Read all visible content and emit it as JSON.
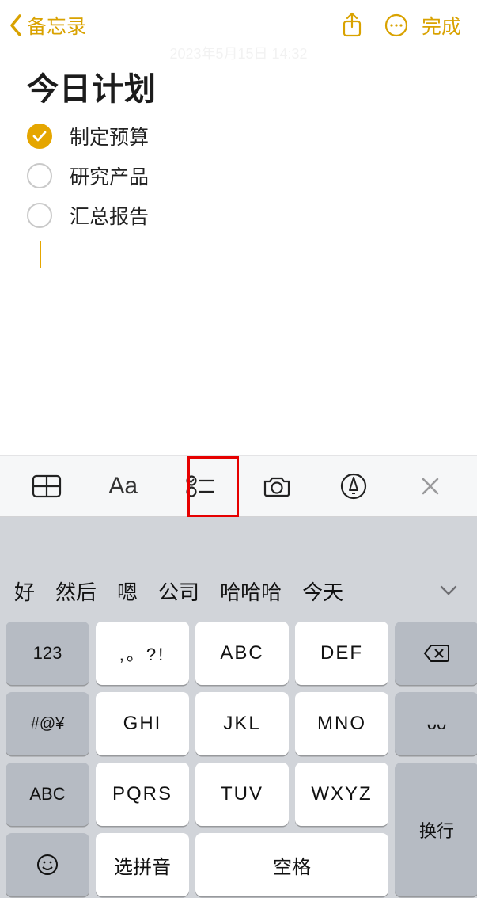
{
  "nav": {
    "back_label": "备忘录",
    "done_label": "完成"
  },
  "note": {
    "timestamp": "2023年5月15日 14:32",
    "title": "今日计划",
    "items": [
      {
        "text": "制定预算",
        "checked": true
      },
      {
        "text": "研究产品",
        "checked": false
      },
      {
        "text": "汇总报告",
        "checked": false
      }
    ]
  },
  "format_bar": {
    "text_style_label": "Aa"
  },
  "suggestions": [
    "好",
    "然后",
    "嗯",
    "公司",
    "哈哈哈",
    "今天"
  ],
  "keyboard": {
    "num_key": "123",
    "punct_key": ",。?!",
    "abc_key": "ABC",
    "def_key": "DEF",
    "sym_key": "#@¥",
    "ghi_key": "GHI",
    "jkl_key": "JKL",
    "mno_key": "MNO",
    "face_key": "ᴗᴗ",
    "shift_key": "ABC",
    "pqrs_key": "PQRS",
    "tuv_key": "TUV",
    "wxyz_key": "WXYZ",
    "return_key": "换行",
    "pinyin_key": "选拼音",
    "space_key": "空格"
  }
}
